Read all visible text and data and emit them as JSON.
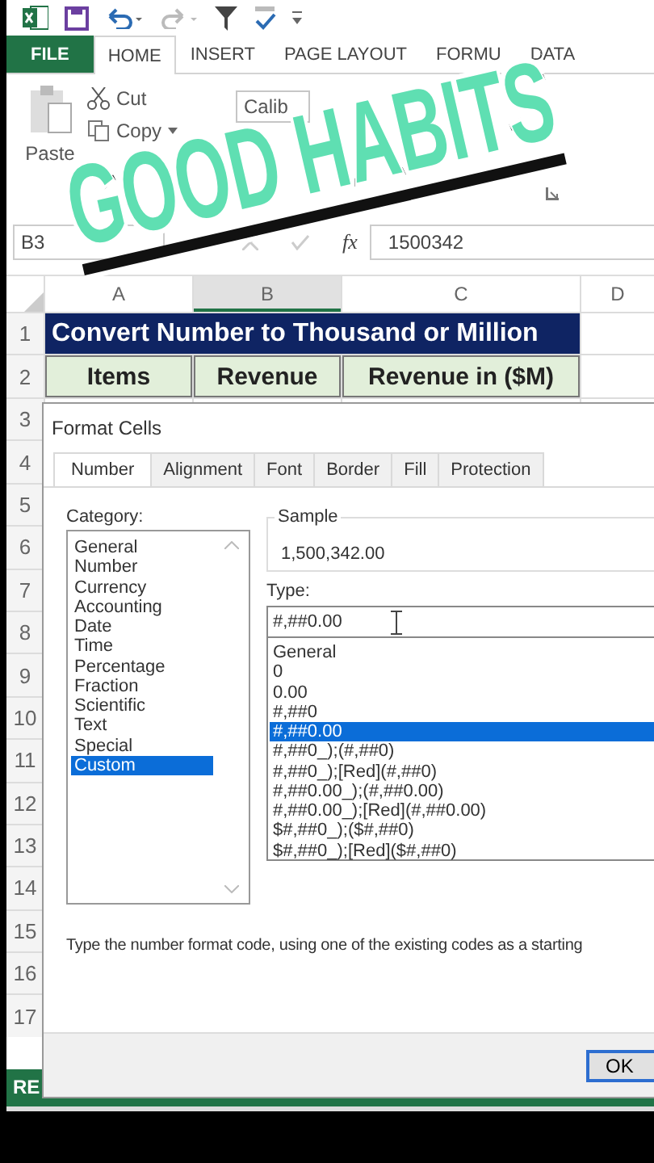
{
  "ribbon": {
    "tabs": [
      {
        "label": "FILE",
        "kind": "file",
        "selected": false
      },
      {
        "label": "HOME",
        "kind": "tab",
        "selected": true
      },
      {
        "label": "INSERT",
        "kind": "tab",
        "selected": false
      },
      {
        "label": "PAGE LAYOUT",
        "kind": "tab",
        "selected": false
      },
      {
        "label": "FORMU",
        "kind": "tab",
        "selected": false
      },
      {
        "label": "DATA",
        "kind": "tab",
        "selected": false
      }
    ],
    "paste": "Paste",
    "cut": "Cut",
    "copy": "Copy",
    "font_box": "Calib"
  },
  "formula_bar": {
    "name_box": "B3",
    "function_label": "fx",
    "value": "1500342"
  },
  "sheet": {
    "columns": [
      "A",
      "B",
      "C",
      "D"
    ],
    "title_row": {
      "number": "1",
      "text": "Convert Number to Thousand or Million"
    },
    "header_row": {
      "number": "2",
      "cells": [
        "Items",
        "Revenue",
        "Revenue in ($M)"
      ]
    },
    "row_numbers": [
      "3",
      "4",
      "5",
      "6",
      "7",
      "8",
      "9",
      "10",
      "11",
      "12",
      "13",
      "14",
      "15",
      "16",
      "17"
    ]
  },
  "dialog": {
    "title": "Format Cells",
    "tabs": [
      {
        "label": "Number",
        "selected": true
      },
      {
        "label": "Alignment",
        "selected": false
      },
      {
        "label": "Font",
        "selected": false
      },
      {
        "label": "Border",
        "selected": false
      },
      {
        "label": "Fill",
        "selected": false
      },
      {
        "label": "Protection",
        "selected": false
      }
    ],
    "category_label": "Category:",
    "categories": [
      {
        "label": "General",
        "selected": false
      },
      {
        "label": "Number",
        "selected": false
      },
      {
        "label": "Currency",
        "selected": false
      },
      {
        "label": "Accounting",
        "selected": false
      },
      {
        "label": "Date",
        "selected": false
      },
      {
        "label": "Time",
        "selected": false
      },
      {
        "label": "Percentage",
        "selected": false
      },
      {
        "label": "Fraction",
        "selected": false
      },
      {
        "label": "Scientific",
        "selected": false
      },
      {
        "label": "Text",
        "selected": false
      },
      {
        "label": "Special",
        "selected": false
      },
      {
        "label": "Custom",
        "selected": true
      }
    ],
    "sample_label": "Sample",
    "sample_value": "1,500,342.00",
    "type_label": "Type:",
    "type_value": "#,##0.00",
    "formats": [
      {
        "label": "General",
        "selected": false
      },
      {
        "label": "0",
        "selected": false
      },
      {
        "label": "0.00",
        "selected": false
      },
      {
        "label": "#,##0",
        "selected": false
      },
      {
        "label": "#,##0.00",
        "selected": true
      },
      {
        "label": "#,##0_);(#,##0)",
        "selected": false
      },
      {
        "label": "#,##0_);[Red](#,##0)",
        "selected": false
      },
      {
        "label": "#,##0.00_);(#,##0.00)",
        "selected": false
      },
      {
        "label": "#,##0.00_);[Red](#,##0.00)",
        "selected": false
      },
      {
        "label": "$#,##0_);($#,##0)",
        "selected": false
      },
      {
        "label": "$#,##0_);[Red]($#,##0)",
        "selected": false
      }
    ],
    "description": "Type the number format code, using one of the existing codes as a starting",
    "ok": "OK"
  },
  "status_bar": {
    "text": "RE"
  },
  "overlay": {
    "text": "GOOD HABITS"
  }
}
